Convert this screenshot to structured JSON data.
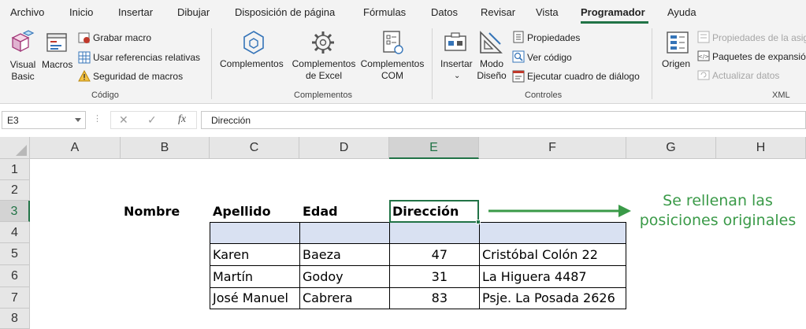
{
  "menu": {
    "tabs": [
      "Archivo",
      "Inicio",
      "Insertar",
      "Dibujar",
      "Disposición de página",
      "Fórmulas",
      "Datos",
      "Revisar",
      "Vista",
      "Programador",
      "Ayuda"
    ],
    "active_tab": "Programador"
  },
  "ribbon": {
    "codigo": {
      "label": "Código",
      "visual_basic": "Visual\nBasic",
      "macros": "Macros",
      "grabar_macro": "Grabar macro",
      "usar_referencias": "Usar referencias relativas",
      "seguridad": "Seguridad de macros"
    },
    "complementos": {
      "label": "Complementos",
      "complementos": "Complementos",
      "complementos_excel": "Complementos\nde Excel",
      "complementos_com": "Complementos\nCOM"
    },
    "controles": {
      "label": "Controles",
      "insertar": "Insertar",
      "modo_diseno": "Modo\nDiseño",
      "propiedades": "Propiedades",
      "ver_codigo": "Ver código",
      "ejecutar_cuadro": "Ejecutar cuadro de diálogo"
    },
    "xml": {
      "label": "XML",
      "origen": "Origen",
      "propiedades_asig": "Propiedades de la asig",
      "paquetes_expansion": "Paquetes de expansió",
      "actualizar_datos": "Actualizar datos"
    }
  },
  "formula_bar": {
    "name_box": "E3",
    "fx": "fx",
    "content": "Dirección"
  },
  "columns": [
    "A",
    "B",
    "C",
    "D",
    "E",
    "F",
    "G",
    "H"
  ],
  "selected_column": "E",
  "rows": [
    "1",
    "2",
    "3",
    "4",
    "5",
    "6",
    "7",
    "8"
  ],
  "selected_row": "3",
  "sheet": {
    "headers": {
      "nombre": "Nombre",
      "apellido": "Apellido",
      "edad": "Edad",
      "direccion": "Dirección"
    },
    "data_rows": [
      {
        "apellido": "Karen",
        "edad": "Baeza",
        "num": "47",
        "direccion": "Cristóbal Colón 22"
      },
      {
        "apellido": "Martín",
        "edad": "Godoy",
        "num": "31",
        "direccion": "La Higuera 4487"
      },
      {
        "apellido": "José Manuel",
        "edad": "Cabrera",
        "num": "83",
        "direccion": "Psje. La Posada 2626"
      }
    ],
    "annotation": "Se rellenan las\nposiciones originales"
  },
  "colors": {
    "accent_green": "#217346",
    "annotation_green": "#3a9a48",
    "table_fill": "#d9e1f2"
  }
}
